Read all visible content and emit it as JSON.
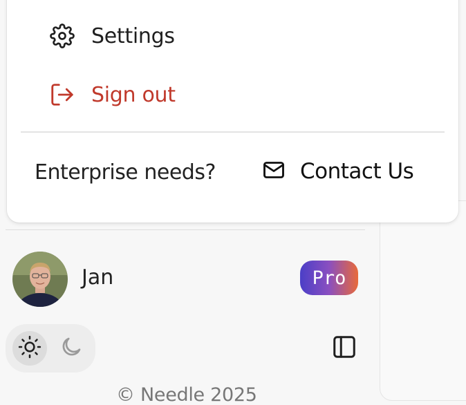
{
  "menu": {
    "settings_label": "Settings",
    "settings_icon": "gear-icon",
    "signout_label": "Sign out",
    "signout_icon": "sign-out-icon",
    "signout_color": "#c0392b",
    "enterprise_text": "Enterprise needs?",
    "contact_label": "Contact Us",
    "contact_icon": "mail-icon"
  },
  "user": {
    "name": "Jan",
    "badge": "Pro",
    "badge_gradient": [
      "#4b3fc7",
      "#8a4fc0",
      "#e86a3a"
    ]
  },
  "theme": {
    "selected": "light",
    "light_icon": "sun-icon",
    "dark_icon": "moon-icon"
  },
  "sidebar": {
    "collapse_icon": "sidebar-toggle-icon"
  },
  "footer": {
    "copyright": "© Needle 2025"
  }
}
